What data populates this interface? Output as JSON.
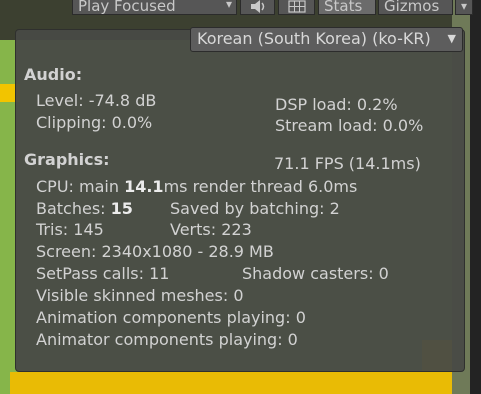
{
  "toolbar": {
    "play_mode": "Play Focused",
    "audio_icon": "speaker-mute-icon",
    "grid_icon": "grid-icon",
    "stats_label": "Stats",
    "gizmos_label": "Gizmos"
  },
  "language_select": {
    "value": "Korean (South Korea) (ko-KR)"
  },
  "audio": {
    "heading": "Audio:",
    "level": "Level: -74.8 dB",
    "clipping": "Clipping: 0.0%",
    "dsp_load": "DSP load: 0.2%",
    "stream_load": "Stream load: 0.0%"
  },
  "graphics": {
    "heading": "Graphics:",
    "fps": "71.1 FPS (14.1ms)",
    "cpu_prefix": "CPU: main ",
    "cpu_main": "14.1",
    "cpu_suffix": "ms  render thread 6.0ms",
    "batches_prefix": "Batches: ",
    "batches": "15",
    "saved_by_batching": "Saved by batching: 2",
    "tris": "Tris: 145",
    "verts": "Verts: 223",
    "screen": "Screen: 2340x1080 - 28.9 MB",
    "setpass": "SetPass calls: 11",
    "shadow_casters": "Shadow casters: 0",
    "skinned_meshes": "Visible skinned meshes: 0",
    "animation_components": "Animation components playing: 0",
    "animator_components": "Animator components playing: 0"
  },
  "colors": {
    "panel_bg": "#484a46",
    "text": "#d2d2d2",
    "scene_green": "#86b54a",
    "scene_yellow": "#e9bb05"
  }
}
